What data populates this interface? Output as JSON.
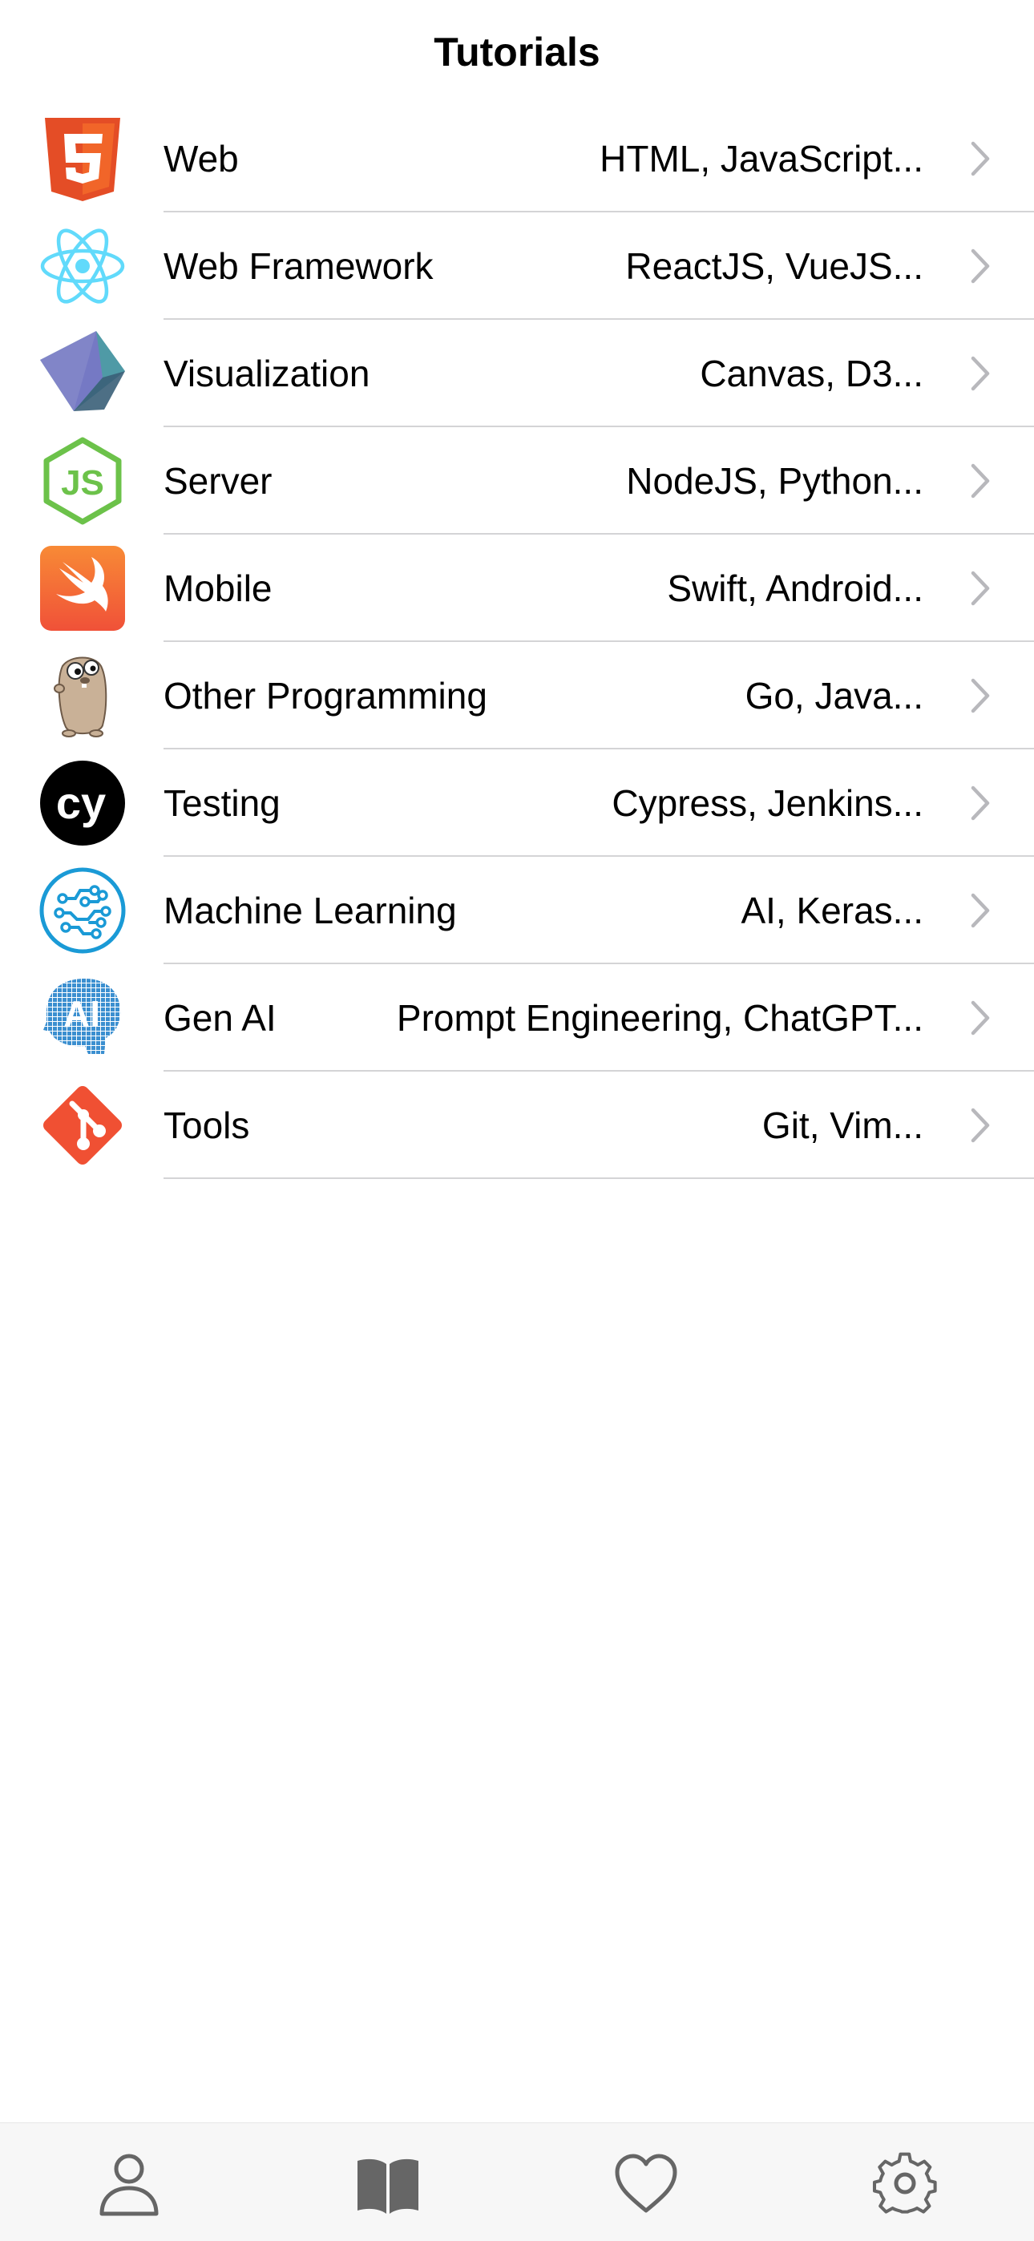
{
  "header": {
    "title": "Tutorials"
  },
  "colors": {
    "separator": "#d4d4d6",
    "chevron": "#b8b8bc",
    "tab_icon": "#666666",
    "tab_bar_bg": "#f7f7f7"
  },
  "list": {
    "items": [
      {
        "label": "Web",
        "detail": "HTML, JavaScript...",
        "icon": "html5-icon"
      },
      {
        "label": "Web Framework",
        "detail": "ReactJS, VueJS...",
        "icon": "react-icon"
      },
      {
        "label": "Visualization",
        "detail": "Canvas, D3...",
        "icon": "visualization-prism-icon"
      },
      {
        "label": "Server",
        "detail": "NodeJS, Python...",
        "icon": "nodejs-icon"
      },
      {
        "label": "Mobile",
        "detail": "Swift, Android...",
        "icon": "swift-icon"
      },
      {
        "label": "Other Programming",
        "detail": "Go, Java...",
        "icon": "go-gopher-icon"
      },
      {
        "label": "Testing",
        "detail": "Cypress, Jenkins...",
        "icon": "cypress-icon"
      },
      {
        "label": "Machine Learning",
        "detail": "AI, Keras...",
        "icon": "machine-learning-circuit-icon"
      },
      {
        "label": "Gen AI",
        "detail": "Prompt Engineering, ChatGPT...",
        "icon": "gen-ai-head-icon"
      },
      {
        "label": "Tools",
        "detail": "Git, Vim...",
        "icon": "git-icon"
      }
    ]
  },
  "tabbar": {
    "tabs": [
      {
        "icon": "person-icon"
      },
      {
        "icon": "book-icon"
      },
      {
        "icon": "heart-icon"
      },
      {
        "icon": "gear-icon"
      }
    ]
  }
}
